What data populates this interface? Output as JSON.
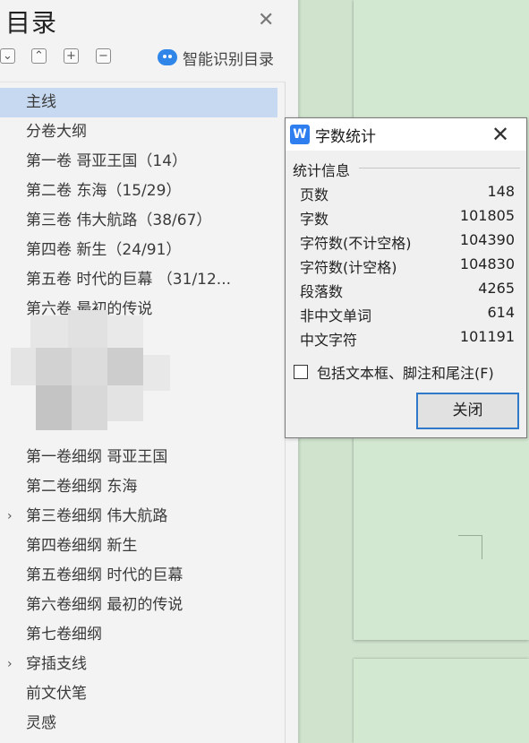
{
  "nav": {
    "title": "目录",
    "toolbar": {
      "collapse_all": "⌄",
      "expand_up": "⌃",
      "add": "+",
      "remove": "−"
    },
    "ai_button_label": "智能识别目录",
    "items": [
      {
        "label": "主线",
        "selected": true
      },
      {
        "label": "分卷大纲"
      },
      {
        "label": "第一卷    哥亚王国（14）"
      },
      {
        "label": "第二卷     东海（15/29）"
      },
      {
        "label": "第三卷    伟大航路（38/67）"
      },
      {
        "label": "第四卷    新生（24/91）"
      },
      {
        "label": "第五卷     时代的巨幕  （31/12..."
      },
      {
        "label": "第六卷    最初的传说"
      },
      {
        "label": "第一卷细纲  哥亚王国"
      },
      {
        "label": "第二卷细纲  东海"
      },
      {
        "label": "第三卷细纲    伟大航路",
        "expandable": true
      },
      {
        "label": "第四卷细纲    新生"
      },
      {
        "label": "第五卷细纲    时代的巨幕"
      },
      {
        "label": "第六卷细纲    最初的传说"
      },
      {
        "label": "第七卷细纲"
      },
      {
        "label": "穿插支线",
        "expandable": true
      },
      {
        "label": "前文伏笔"
      },
      {
        "label": "灵感"
      }
    ]
  },
  "dialog": {
    "title": "字数统计",
    "icon_letter": "W",
    "group_title": "统计信息",
    "stats": [
      {
        "label": "页数",
        "value": "148"
      },
      {
        "label": "字数",
        "value": "101805"
      },
      {
        "label": "字符数(不计空格)",
        "value": "104390"
      },
      {
        "label": "字符数(计空格)",
        "value": "104830"
      },
      {
        "label": "段落数",
        "value": "4265"
      },
      {
        "label": "非中文单词",
        "value": "614"
      },
      {
        "label": "中文字符",
        "value": "101191"
      }
    ],
    "checkbox_label": "包括文本框、脚注和尾注(F)",
    "checkbox_checked": false,
    "close_button": "关闭"
  },
  "colors": {
    "selection": "#c7d9f1",
    "document_bg": "#cfe3cd",
    "accent": "#2f7ef0"
  }
}
